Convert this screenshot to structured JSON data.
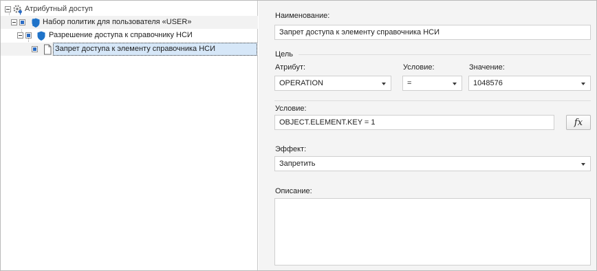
{
  "tree": {
    "root": {
      "label": "Атрибутный доступ",
      "icon": "gear-key-icon"
    },
    "policy_set": {
      "label": "Набор политик для пользователя «USER»",
      "icon": "shield-icon"
    },
    "policy": {
      "label": "Разрешение доступа к справочнику НСИ",
      "icon": "shield-icon"
    },
    "rule": {
      "label": "Запрет доступа к элементу справочника НСИ",
      "icon": "document-icon"
    }
  },
  "form": {
    "name_label": "Наименование:",
    "name_value": "Запрет доступа к элементу справочника НСИ",
    "target_section": "Цель",
    "attribute_label": "Атрибут:",
    "attribute_value": "OPERATION",
    "operator_label": "Условие:",
    "operator_value": "=",
    "value_label": "Значение:",
    "value_value": "1048576",
    "condition_label": "Условие:",
    "condition_value": "OBJECT.ELEMENT.KEY = 1",
    "fx_button_label": "fx",
    "effect_label": "Эффект:",
    "effect_value": "Запретить",
    "description_label": "Описание:",
    "description_value": ""
  },
  "colors": {
    "selection_bg": "#d6e7f8",
    "checkbox_blue": "#2b6cc4",
    "shield_blue": "#1f73c9",
    "panel_bg": "#f4f4f4"
  }
}
